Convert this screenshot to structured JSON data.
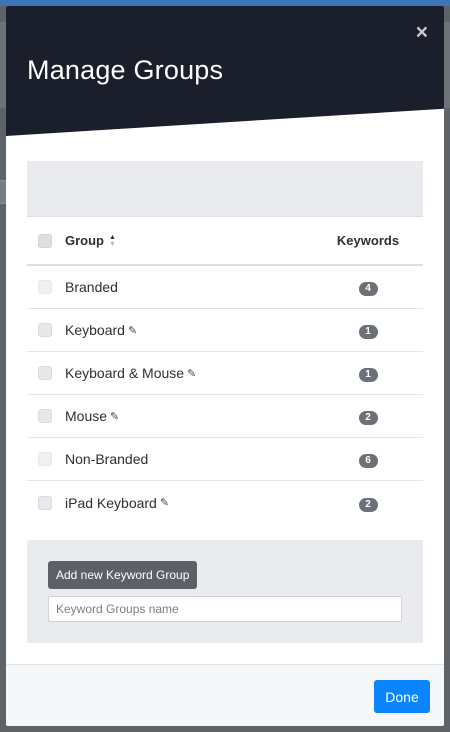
{
  "modal": {
    "title": "Manage Groups",
    "close_glyph": "×"
  },
  "table": {
    "headers": {
      "group": "Group",
      "keywords": "Keywords"
    },
    "rows": [
      {
        "name": "Branded",
        "count": "4",
        "editable": false
      },
      {
        "name": "Keyboard",
        "count": "1",
        "editable": true
      },
      {
        "name": "Keyboard & Mouse",
        "count": "1",
        "editable": true
      },
      {
        "name": "Mouse",
        "count": "2",
        "editable": true
      },
      {
        "name": "Non-Branded",
        "count": "6",
        "editable": false
      },
      {
        "name": "iPad Keyboard",
        "count": "2",
        "editable": true
      }
    ]
  },
  "add_group": {
    "button_label": "Add new Keyword Group",
    "input_placeholder": "Keyword Groups name",
    "input_value": ""
  },
  "footer": {
    "done_label": "Done"
  },
  "icons": {
    "close": "close-icon",
    "sort": "sort-icon",
    "edit": "pencil-icon"
  },
  "colors": {
    "header_bg": "#1b1e2b",
    "primary": "#0a84ff",
    "badge": "#6c7177",
    "secondary_button": "#5b6167"
  }
}
